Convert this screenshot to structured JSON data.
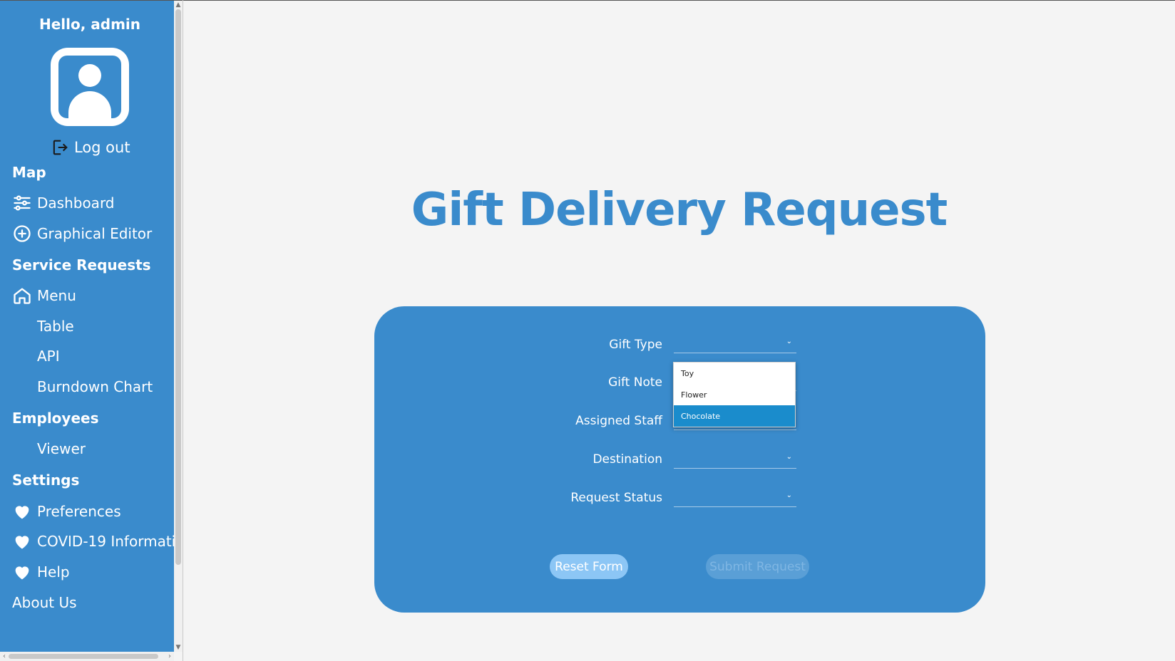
{
  "sidebar": {
    "greeting": "Hello, admin",
    "logout_label": "Log out",
    "sections": {
      "map": "Map",
      "service_requests": "Service Requests",
      "employees": "Employees",
      "settings": "Settings"
    },
    "items": {
      "dashboard": "Dashboard",
      "graphical_editor": "Graphical Editor",
      "menu": "Menu",
      "table": "Table",
      "api": "API",
      "burndown_chart": "Burndown Chart",
      "viewer": "Viewer",
      "preferences": "Preferences",
      "covid": "COVID-19 Informati...",
      "help": "Help",
      "about_us": "About Us"
    }
  },
  "main": {
    "title": "Gift Delivery Request",
    "form": {
      "labels": {
        "gift_type": "Gift Type",
        "gift_note": "Gift Note",
        "assigned_staff": "Assigned Staff",
        "destination": "Destination",
        "request_status": "Request Status"
      },
      "reset_label": "Reset Form",
      "submit_label": "Submit Request"
    },
    "gift_type_dropdown": {
      "options": [
        "Toy",
        "Flower",
        "Chocolate"
      ],
      "highlighted": "Chocolate"
    }
  },
  "colors": {
    "sidebar": "#3a8bcc",
    "accent": "#3a8bcc",
    "highlight": "#1a8ccc",
    "background": "#f4f4f4"
  }
}
